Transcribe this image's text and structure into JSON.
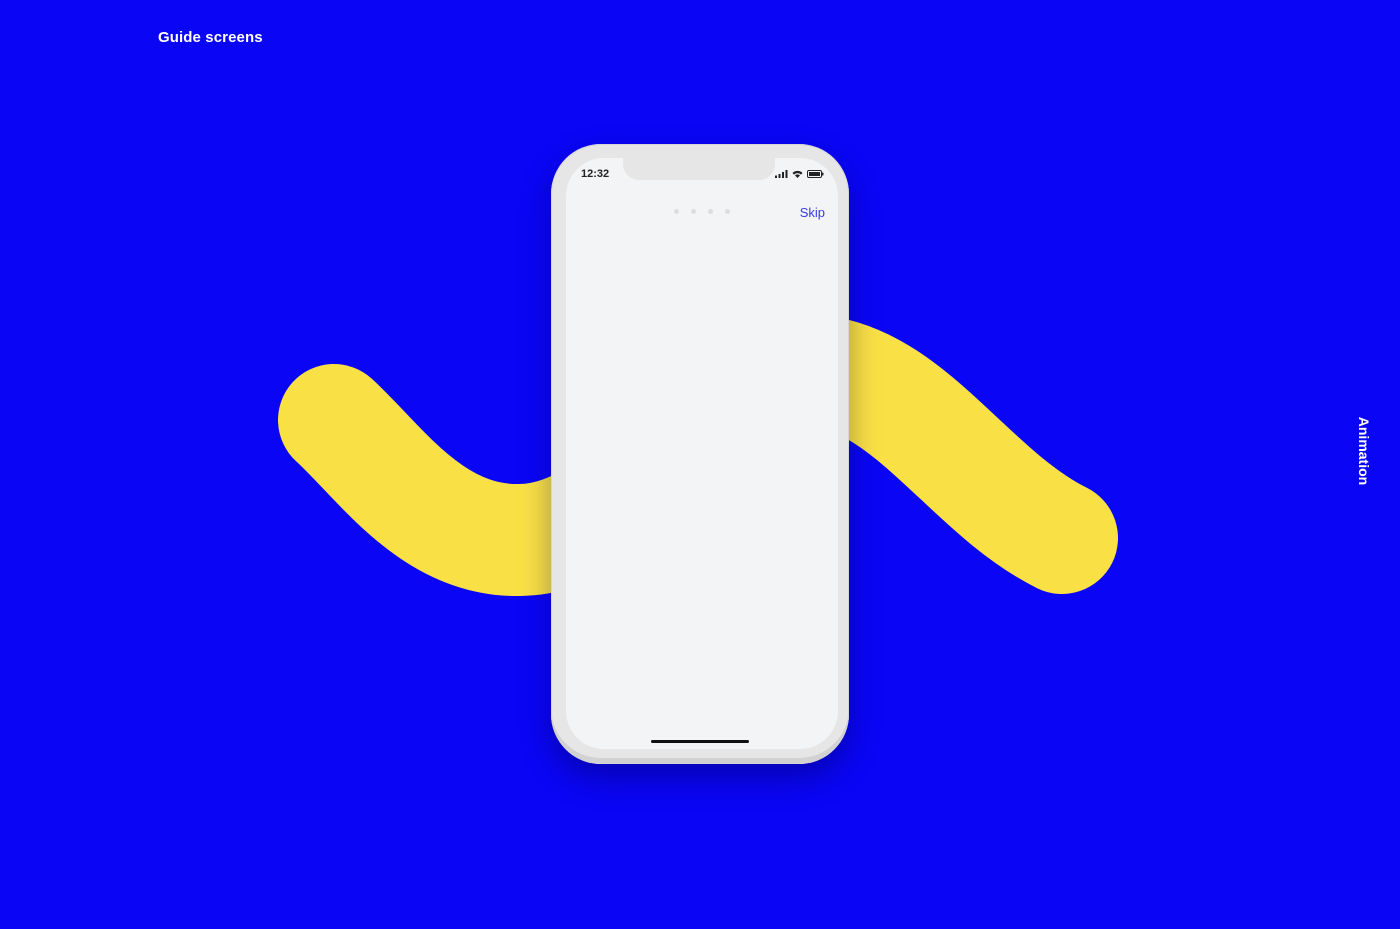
{
  "page": {
    "heading": "Guide screens",
    "side_label": "Animation"
  },
  "phone": {
    "status_bar": {
      "time": "12:32",
      "icons": [
        "signal-icon",
        "wifi-icon",
        "battery-icon"
      ]
    },
    "onboarding": {
      "pager_dots": 4,
      "skip_label": "Skip"
    }
  },
  "colors": {
    "background": "#0a05f5",
    "wave": "#f9e045",
    "screen": "#f3f4f5",
    "accent": "#3a3ae8"
  }
}
